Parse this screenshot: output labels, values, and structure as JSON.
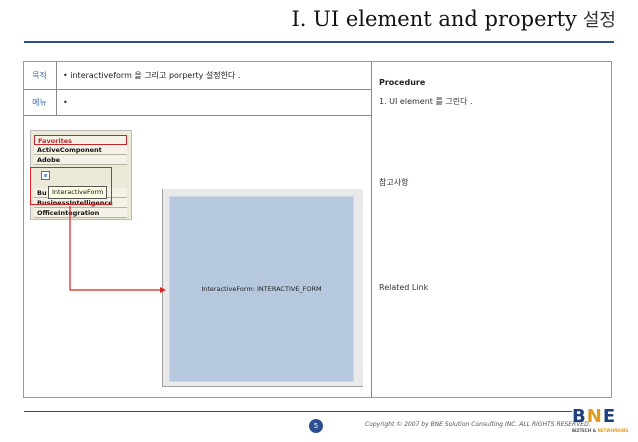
{
  "header": {
    "title": "I. UI element and property",
    "title_korean": "설정"
  },
  "table": {
    "purpose_label": "목적",
    "purpose_value": "• interactiveform 을 그리고  porperty 설정한다 .",
    "menu_label": "메뉴",
    "menu_value": "•"
  },
  "palette": {
    "items": [
      "Favorites",
      "ActiveComponent",
      "Adobe",
      "Bu",
      "BusinessIntelligence",
      "OfficeIntegration"
    ],
    "tooltip": "InteractiveForm"
  },
  "canvas": {
    "label": "InteractiveForm: INTERACTIVE_FORM"
  },
  "sidebar": {
    "procedure_title": "Procedure",
    "step1": "1. UI element 를 그린다 .",
    "reference_label": "참고사항",
    "related_link_label": "Related Link"
  },
  "footer": {
    "page_number": "5",
    "copyright": "Copyright © 2007 by BNE Solution Consulting INC.   ALL RIGHTS RESERVED.",
    "logo_b": "B",
    "logo_n": "N",
    "logo_e": "E",
    "logo_sub_a": "BIZTECH &",
    "logo_sub_b": "NETWORKING"
  },
  "colors": {
    "title_rule": "#2d4d8f",
    "label_text": "#3a6db3",
    "highlight_red": "#d22222",
    "canvas_fill": "#b6c8dd",
    "logo_blue": "#1d3f7a",
    "logo_orange": "#e39a1a"
  },
  "icons": [
    "interactive-form-tool-icon",
    "arrow-connector-icon"
  ]
}
